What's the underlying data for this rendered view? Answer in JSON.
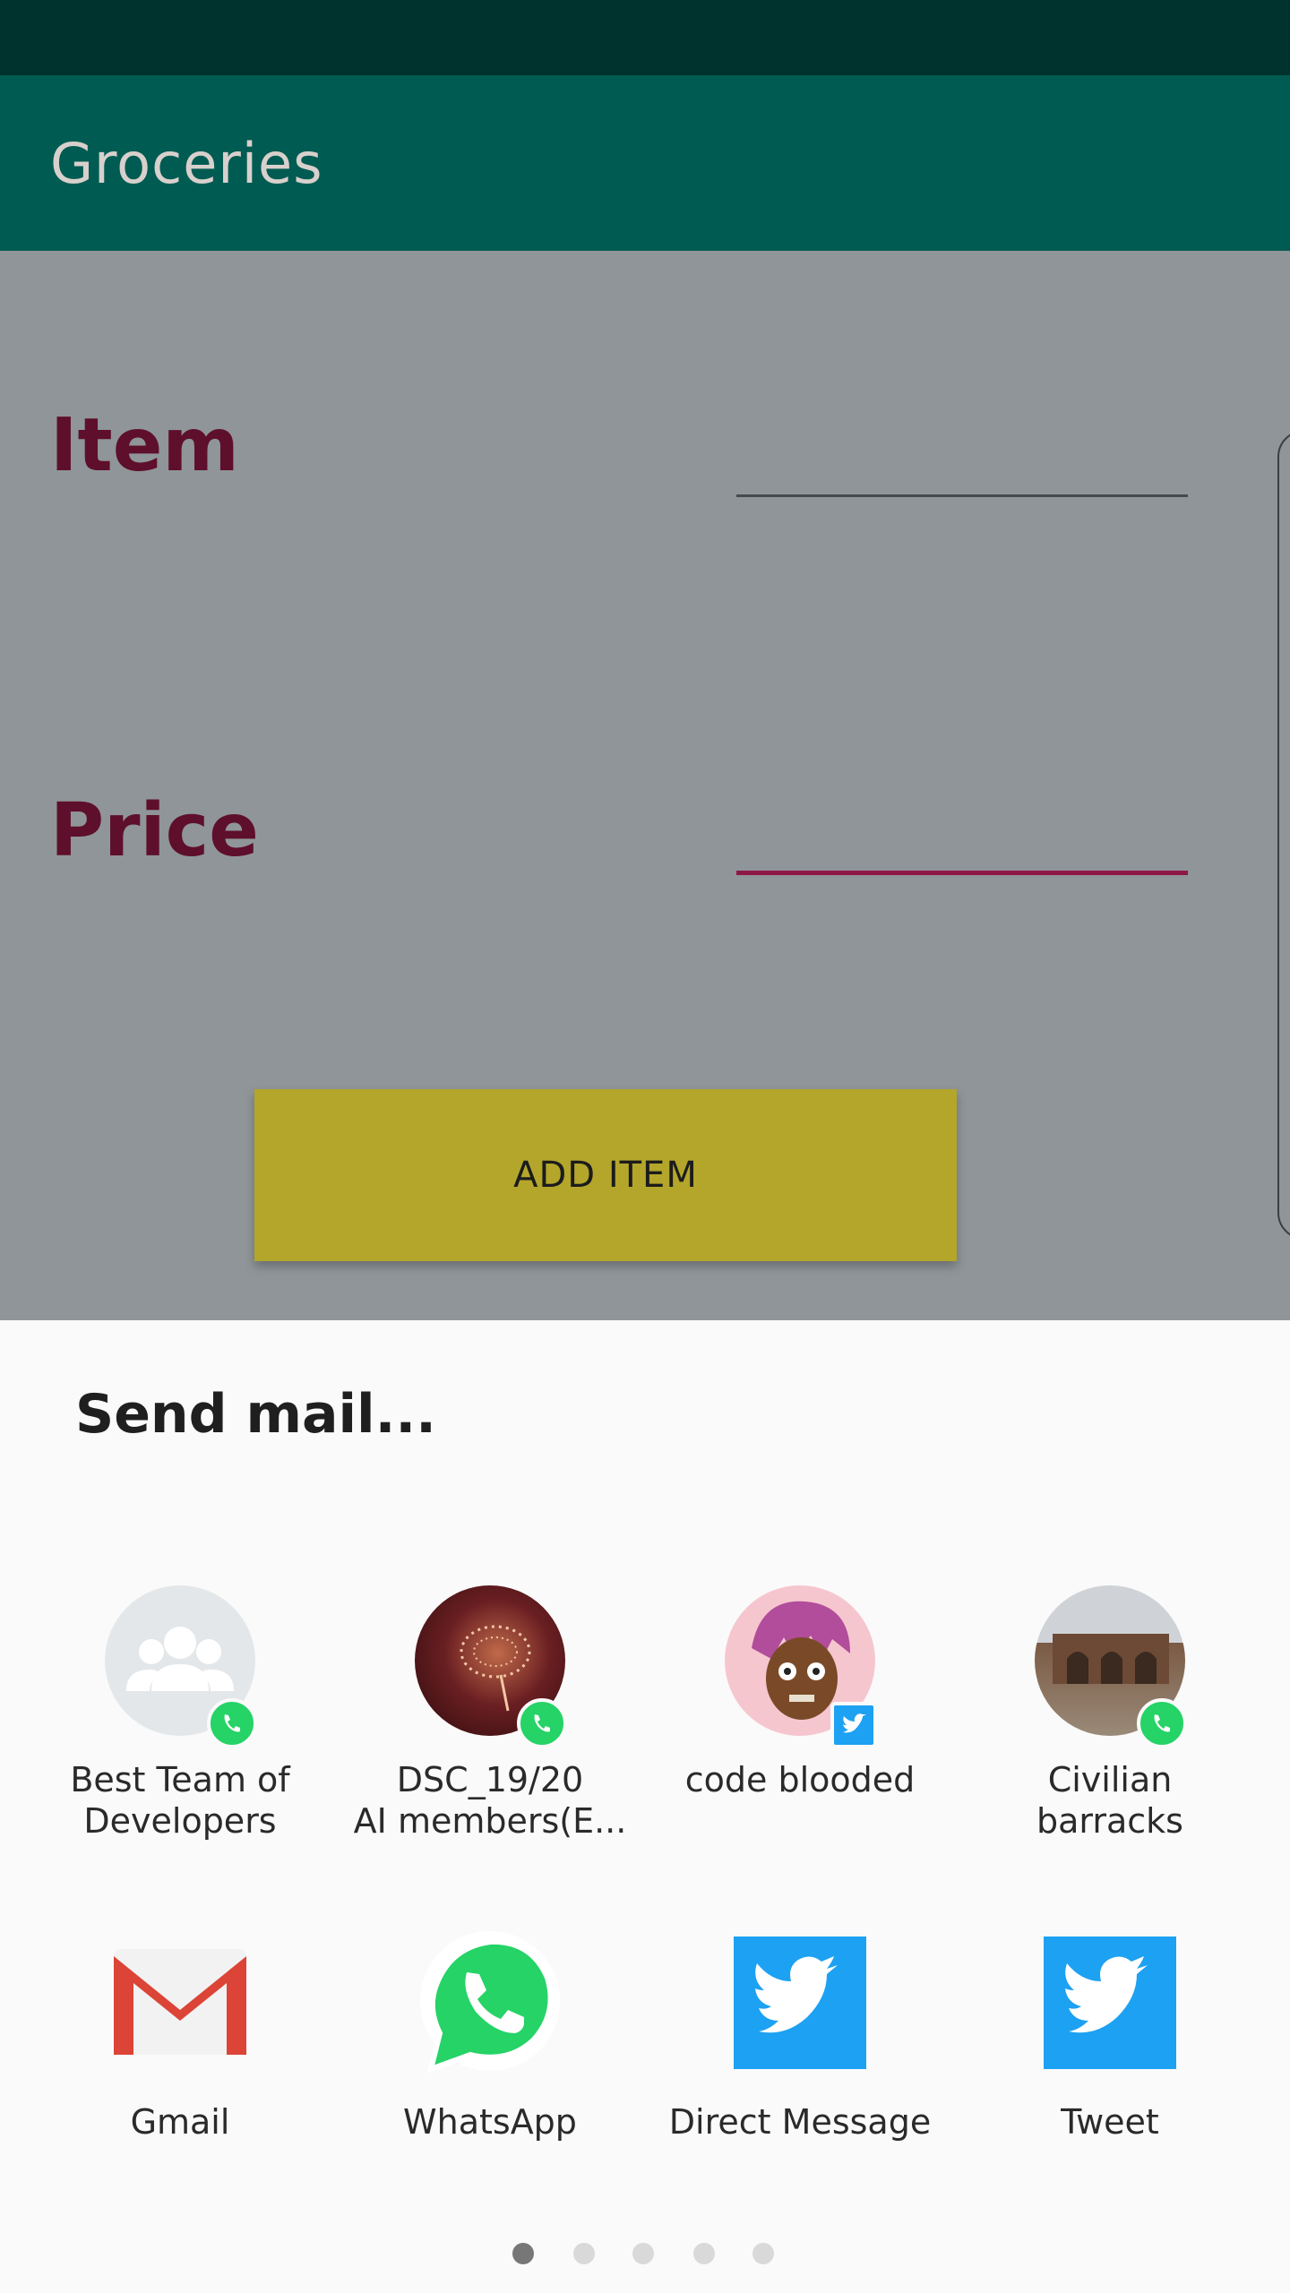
{
  "app_bar": {
    "title": "Groceries"
  },
  "form": {
    "item_label": "Item",
    "item_value": "",
    "price_label": "Price",
    "price_value": "",
    "add_button_label": "ADD ITEM"
  },
  "share_sheet": {
    "title": "Send mail...",
    "direct_targets": [
      {
        "label_line1": "Best Team of",
        "label_line2": "Developers",
        "badge": "whatsapp-badge"
      },
      {
        "label_line1": "DSC_19/20",
        "label_line2": "AI members(E...",
        "badge": "whatsapp-badge"
      },
      {
        "label_line1": "code blooded",
        "label_line2": "",
        "badge": "twitter-badge"
      },
      {
        "label_line1": "Civilian",
        "label_line2": "barracks",
        "badge": "whatsapp-badge"
      }
    ],
    "apps": [
      {
        "label": "Gmail",
        "icon": "gmail-icon"
      },
      {
        "label": "WhatsApp",
        "icon": "whatsapp-icon"
      },
      {
        "label": "Direct Message",
        "icon": "twitter-icon"
      },
      {
        "label": "Tweet",
        "icon": "twitter-icon"
      }
    ],
    "page_count": 5,
    "active_page": 1
  },
  "colors": {
    "status_bar": "#00332e",
    "app_bar": "#005b52",
    "label_text": "#5e0f2b",
    "price_underline": "#8e1746",
    "add_button": "#b3a62a",
    "whatsapp_green": "#25d366",
    "twitter_blue": "#1da1f2",
    "gmail_red": "#db4437"
  }
}
